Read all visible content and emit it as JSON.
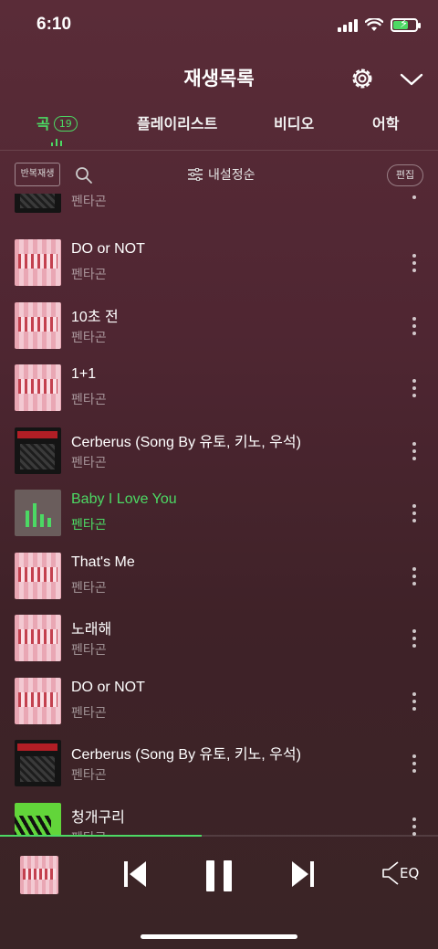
{
  "status": {
    "time": "6:10"
  },
  "header": {
    "title": "재생목록"
  },
  "tabs": [
    {
      "label": "곡",
      "badge": "19"
    },
    {
      "label": "플레이리스트"
    },
    {
      "label": "비디오"
    },
    {
      "label": "어학"
    }
  ],
  "toolbar": {
    "repeat_label": "반복재생",
    "sort_label": "내설정순",
    "edit_label": "편집"
  },
  "songs": [
    {
      "title": "",
      "artist": "펜타곤"
    },
    {
      "title": "DO or NOT",
      "artist": "펜타곤"
    },
    {
      "title": "10초 전",
      "artist": "펜타곤"
    },
    {
      "title": "1+1",
      "artist": "펜타곤"
    },
    {
      "title": "Cerberus (Song By 유토, 키노, 우석)",
      "artist": "펜타곤"
    },
    {
      "title": "Baby I Love You",
      "artist": "펜타곤"
    },
    {
      "title": "That's Me",
      "artist": "펜타곤"
    },
    {
      "title": "노래해",
      "artist": "펜타곤"
    },
    {
      "title": "DO or NOT",
      "artist": "펜타곤"
    },
    {
      "title": "Cerberus (Song By 유토, 키노, 우석)",
      "artist": "펜타곤"
    },
    {
      "title": "청개구리",
      "artist": "펜타곤"
    }
  ],
  "player": {
    "eq_label": "EQ",
    "progress": 0.46
  },
  "colors": {
    "accent": "#4cd964"
  }
}
